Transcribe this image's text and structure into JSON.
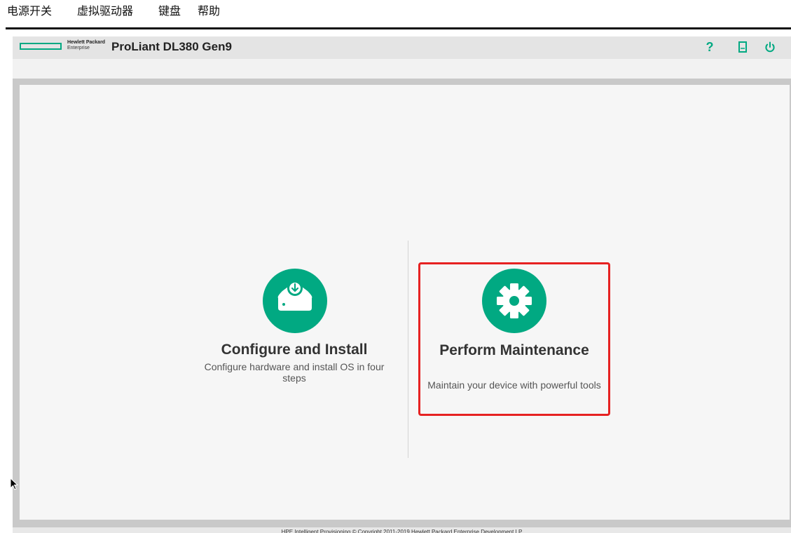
{
  "menubar": {
    "items": [
      "电源开关",
      "虚拟驱动器",
      "键盘",
      "帮助"
    ]
  },
  "header": {
    "brand_line1": "Hewlett Packard",
    "brand_line2": "Enterprise",
    "product_title": "ProLiant DL380 Gen9",
    "help_glyph": "?",
    "icons": [
      "help-icon",
      "document-icon",
      "power-icon"
    ]
  },
  "options": {
    "configure": {
      "title": "Configure and Install",
      "description": "Configure hardware and install OS in four steps",
      "icon": "disk-download-icon"
    },
    "maintenance": {
      "title": "Perform Maintenance",
      "description": "Maintain your device with powerful tools",
      "icon": "gear-icon",
      "highlighted": true
    }
  },
  "footer": {
    "text": "HPE Intelligent Provisioning  © Copyright 2011-2019 Hewlett Packard Enterprise Development LP"
  },
  "colors": {
    "accent": "#01a982",
    "highlight": "#e62222"
  }
}
